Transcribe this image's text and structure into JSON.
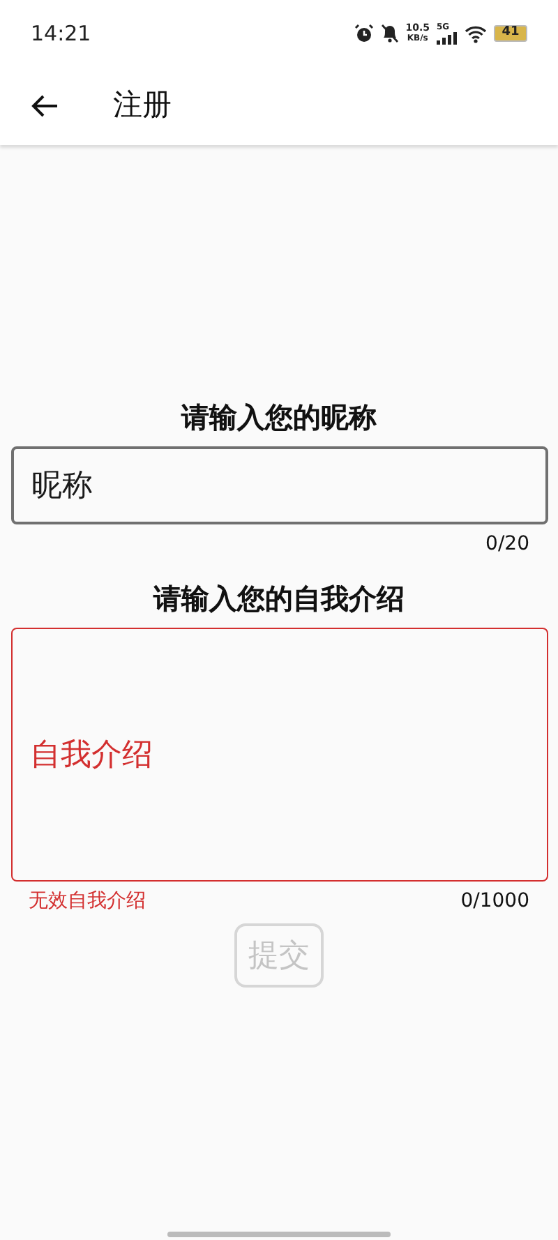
{
  "status_bar": {
    "time": "14:21",
    "net_speed": "10.5",
    "net_unit": "KB/s",
    "network": "5G",
    "battery": "41"
  },
  "app_bar": {
    "title": "注册"
  },
  "fields": [
    {
      "label": "请输入您的昵称",
      "placeholder": "昵称",
      "counter": "0/20",
      "error": false,
      "kind": "single"
    },
    {
      "label": "请输入您的自我介绍",
      "placeholder": "自我介绍",
      "counter": "0/1000",
      "error": true,
      "error_text": "无效自我介绍",
      "kind": "multi"
    }
  ],
  "submit": {
    "label": "提交",
    "disabled": true
  }
}
